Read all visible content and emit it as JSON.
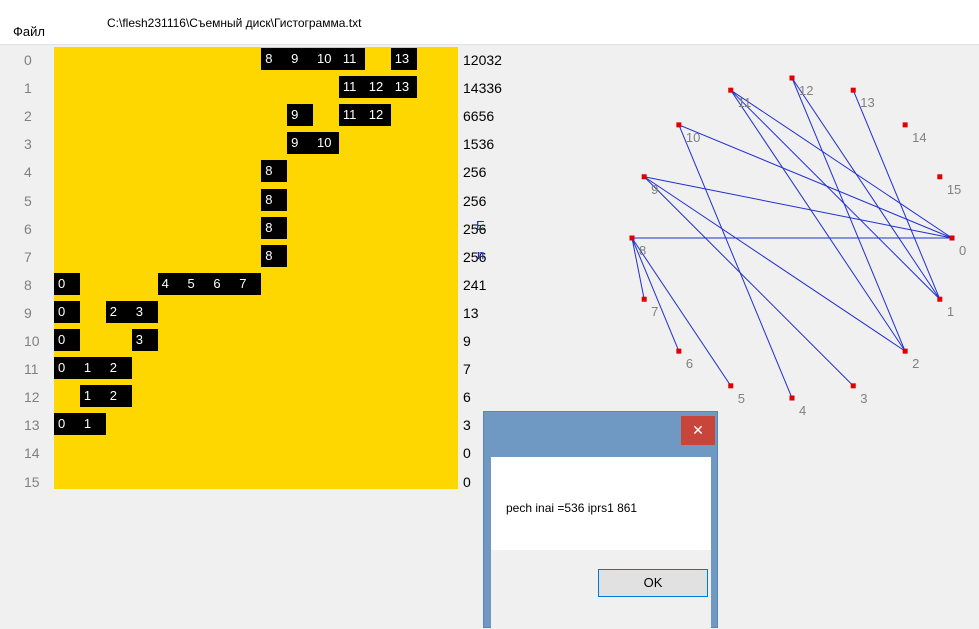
{
  "menu": {
    "file_label": "Файл"
  },
  "file_path": "C:\\flesh231116\\Съемный диск\\Гистограмма.txt",
  "rows": [
    {
      "label": "0",
      "count": "12032",
      "cells": [
        {
          "col": 8,
          "text": "8"
        },
        {
          "col": 9,
          "text": "9"
        },
        {
          "col": 10,
          "text": "10"
        },
        {
          "col": 11,
          "text": "11"
        },
        {
          "col": 13,
          "text": "13"
        }
      ]
    },
    {
      "label": "1",
      "count": "14336",
      "cells": [
        {
          "col": 11,
          "text": "11"
        },
        {
          "col": 12,
          "text": "12"
        },
        {
          "col": 13,
          "text": "13"
        }
      ]
    },
    {
      "label": "2",
      "count": "6656",
      "cells": [
        {
          "col": 9,
          "text": "9"
        },
        {
          "col": 11,
          "text": "11"
        },
        {
          "col": 12,
          "text": "12"
        }
      ]
    },
    {
      "label": "3",
      "count": "1536",
      "cells": [
        {
          "col": 9,
          "text": "9"
        },
        {
          "col": 10,
          "text": "10"
        }
      ]
    },
    {
      "label": "4",
      "count": "256",
      "cells": [
        {
          "col": 8,
          "text": "8"
        }
      ]
    },
    {
      "label": "5",
      "count": "256",
      "cells": [
        {
          "col": 8,
          "text": "8"
        }
      ]
    },
    {
      "label": "6",
      "count": "256",
      "cells": [
        {
          "col": 8,
          "text": "8"
        }
      ]
    },
    {
      "label": "7",
      "count": "256",
      "cells": [
        {
          "col": 8,
          "text": "8"
        }
      ]
    },
    {
      "label": "8",
      "count": "241",
      "cells": [
        {
          "col": 0,
          "text": "0"
        },
        {
          "col": 4,
          "text": "4"
        },
        {
          "col": 5,
          "text": "5"
        },
        {
          "col": 6,
          "text": "6"
        },
        {
          "col": 7,
          "text": "7"
        }
      ]
    },
    {
      "label": "9",
      "count": "13",
      "cells": [
        {
          "col": 0,
          "text": "0"
        },
        {
          "col": 2,
          "text": "2"
        },
        {
          "col": 3,
          "text": "3"
        }
      ]
    },
    {
      "label": "10",
      "count": "9",
      "cells": [
        {
          "col": 0,
          "text": "0"
        },
        {
          "col": 3,
          "text": "3"
        }
      ]
    },
    {
      "label": "11",
      "count": "7",
      "cells": [
        {
          "col": 0,
          "text": "0"
        },
        {
          "col": 1,
          "text": "1"
        },
        {
          "col": 2,
          "text": "2"
        }
      ]
    },
    {
      "label": "12",
      "count": "6",
      "cells": [
        {
          "col": 1,
          "text": "1"
        },
        {
          "col": 2,
          "text": "2"
        }
      ]
    },
    {
      "label": "13",
      "count": "3",
      "cells": [
        {
          "col": 0,
          "text": "0"
        },
        {
          "col": 1,
          "text": "1"
        }
      ]
    },
    {
      "label": "14",
      "count": "0",
      "cells": []
    },
    {
      "label": "15",
      "count": "0",
      "cells": []
    }
  ],
  "side_markers": {
    "e": "E",
    "n": "n"
  },
  "graph": {
    "nodes": [
      {
        "label": "0"
      },
      {
        "label": "1"
      },
      {
        "label": "2"
      },
      {
        "label": "3"
      },
      {
        "label": "4"
      },
      {
        "label": "5"
      },
      {
        "label": "6"
      },
      {
        "label": "7"
      },
      {
        "label": "8"
      },
      {
        "label": "9"
      },
      {
        "label": "10"
      },
      {
        "label": "11"
      },
      {
        "label": "12"
      },
      {
        "label": "13"
      },
      {
        "label": "14"
      },
      {
        "label": "15"
      }
    ],
    "edges": [
      [
        8,
        0
      ],
      [
        8,
        5
      ],
      [
        8,
        6
      ],
      [
        8,
        7
      ],
      [
        9,
        0
      ],
      [
        9,
        3
      ],
      [
        10,
        0
      ],
      [
        10,
        4
      ],
      [
        11,
        0
      ],
      [
        11,
        1
      ],
      [
        11,
        2
      ],
      [
        12,
        1
      ],
      [
        12,
        2
      ],
      [
        13,
        1
      ],
      [
        9,
        2
      ]
    ],
    "edge_color": "#1f2fd0",
    "node_color": "#e00000",
    "label_color": "#808080"
  },
  "dialog": {
    "message": "pech inai =536 iprs1 861",
    "ok_label": "OK",
    "close_glyph": "✕"
  },
  "colors": {
    "grid_fill": "#ffd700",
    "cell_fill": "#000000"
  }
}
